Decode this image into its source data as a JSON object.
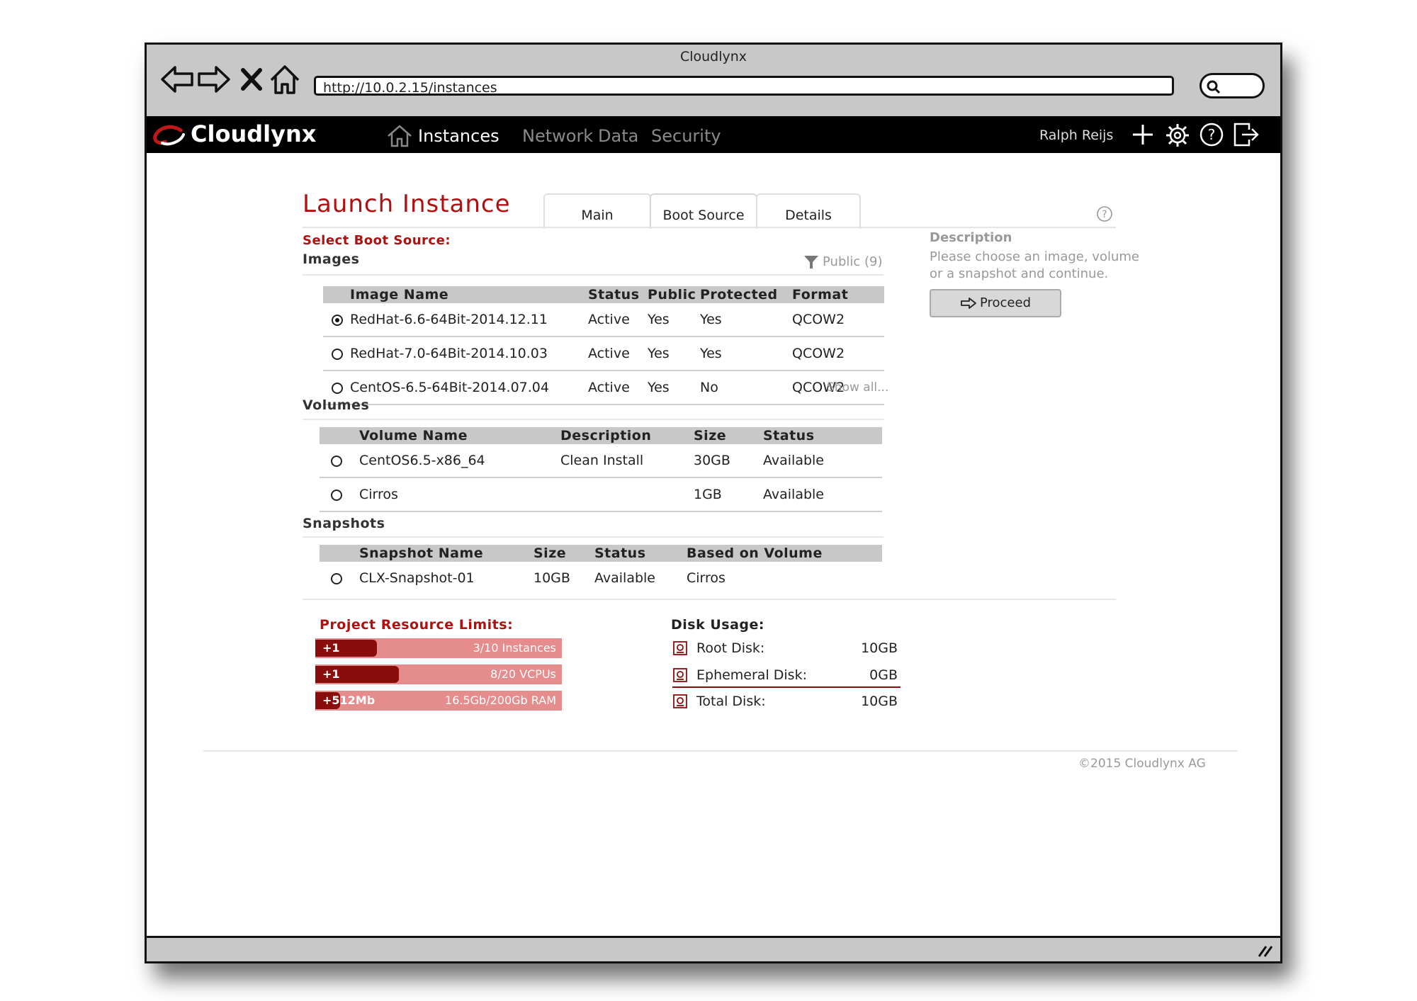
{
  "window": {
    "title": "Cloudlynx"
  },
  "browser": {
    "url": "http://10.0.2.15/instances"
  },
  "app": {
    "brand": "Cloudlynx",
    "nav": [
      {
        "label": "Instances",
        "active": true
      },
      {
        "label": "Network",
        "active": false
      },
      {
        "label": "Data",
        "active": false
      },
      {
        "label": "Security",
        "active": false
      }
    ],
    "user": "Ralph Reijs",
    "accent_color": "#b01010"
  },
  "page": {
    "title": "Launch Instance",
    "tabs": [
      {
        "label": "Main",
        "active": false
      },
      {
        "label": "Boot Source",
        "active": true
      },
      {
        "label": "Details",
        "active": false
      }
    ],
    "select_label": "Select Boot Source:"
  },
  "images": {
    "heading": "Images",
    "filter_label": "Public (9)",
    "columns": [
      "Image Name",
      "Status",
      "Public",
      "Protected",
      "Format"
    ],
    "rows": [
      {
        "selected": true,
        "name": "RedHat-6.6-64Bit-2014.12.11",
        "status": "Active",
        "public": "Yes",
        "protected": "Yes",
        "format": "QCOW2"
      },
      {
        "selected": false,
        "name": "RedHat-7.0-64Bit-2014.10.03",
        "status": "Active",
        "public": "Yes",
        "protected": "Yes",
        "format": "QCOW2"
      },
      {
        "selected": false,
        "name": "CentOS-6.5-64Bit-2014.07.04",
        "status": "Active",
        "public": "Yes",
        "protected": "No",
        "format": "QCOW2"
      }
    ],
    "show_all": "Show all..."
  },
  "volumes": {
    "heading": "Volumes",
    "columns": [
      "Volume Name",
      "Description",
      "Size",
      "Status"
    ],
    "rows": [
      {
        "name": "CentOS6.5-x86_64",
        "description": "Clean Install",
        "size": "30GB",
        "status": "Available"
      },
      {
        "name": "Cirros",
        "description": "",
        "size": "1GB",
        "status": "Available"
      }
    ]
  },
  "snapshots": {
    "heading": "Snapshots",
    "columns": [
      "Snapshot Name",
      "Size",
      "Status",
      "Based on Volume"
    ],
    "rows": [
      {
        "name": "CLX-Snapshot-01",
        "size": "10GB",
        "status": "Available",
        "based_on": "Cirros"
      }
    ]
  },
  "description": {
    "title": "Description",
    "text": "Please choose an image, volume or a snapshot and continue.",
    "proceed_label": "Proceed"
  },
  "limits": {
    "heading": "Project Resource Limits:",
    "items": [
      {
        "icon": "monitor-icon",
        "delta": "+1",
        "label": "3/10 Instances",
        "fraction": 0.25
      },
      {
        "icon": "cpu-icon",
        "delta": "+1",
        "label": "8/20 VCPUs",
        "fraction": 0.34
      },
      {
        "icon": "ram-icon",
        "delta": "+512Mb",
        "label": "16.5Gb/200Gb RAM",
        "fraction": 0.1
      }
    ]
  },
  "disk": {
    "heading": "Disk Usage:",
    "items": [
      {
        "label": "Root Disk:",
        "value": "10GB"
      },
      {
        "label": "Ephemeral Disk:",
        "value": "0GB"
      },
      {
        "label": "Total Disk:",
        "value": "10GB"
      }
    ]
  },
  "footer": {
    "copyright": "©2015 Cloudlynx AG"
  }
}
